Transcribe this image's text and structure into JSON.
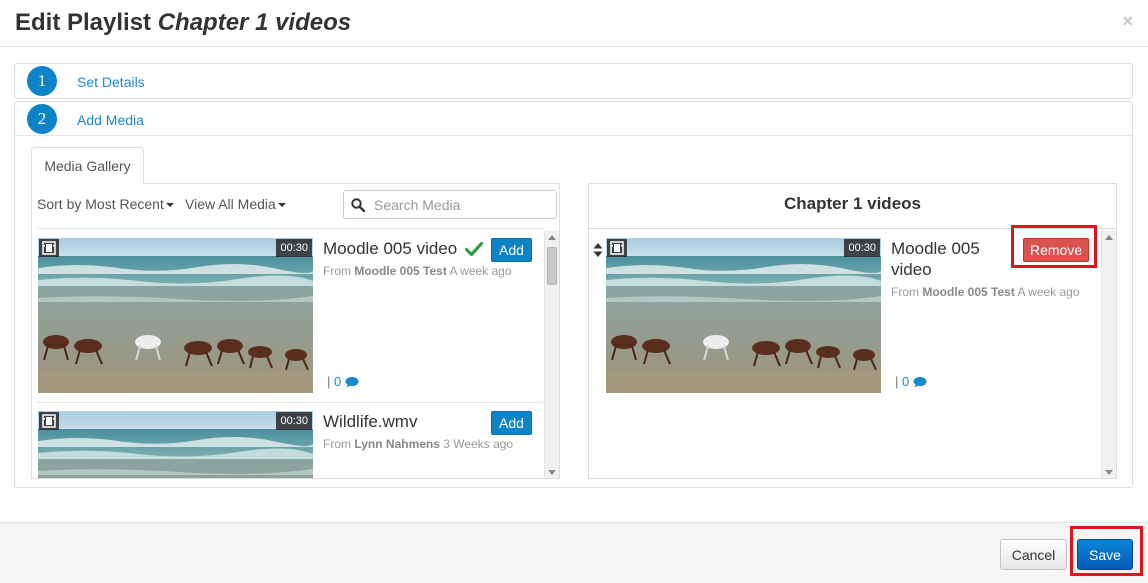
{
  "modal": {
    "title_prefix": "Edit Playlist",
    "title_name": "Chapter 1 videos",
    "close_glyph": "×"
  },
  "steps": [
    {
      "number": "1",
      "label": "Set Details"
    },
    {
      "number": "2",
      "label": "Add Media"
    }
  ],
  "gallery": {
    "tab_label": "Media Gallery",
    "sort_label": "Sort by Most Recent",
    "view_label": "View All Media",
    "search_placeholder": "Search Media",
    "items": [
      {
        "title": "Moodle 005 video",
        "from_label": "From",
        "author": "Moodle 005 Test",
        "time": "A week ago",
        "duration": "00:30",
        "comments": "0",
        "button": "Add",
        "added": true
      },
      {
        "title": "Wildlife.wmv",
        "from_label": "From",
        "author": "Lynn Nahmens",
        "time": "3 Weeks ago",
        "duration": "00:30",
        "button": "Add",
        "added": false
      }
    ]
  },
  "playlist": {
    "title": "Chapter 1 videos",
    "items": [
      {
        "title": "Moodle 005 video",
        "from_label": "From",
        "author": "Moodle 005 Test",
        "time": "A week ago",
        "duration": "00:30",
        "comments": "0",
        "button": "Remove"
      }
    ]
  },
  "footer": {
    "cancel_label": "Cancel",
    "save_label": "Save"
  },
  "colors": {
    "primary": "#0e84c8",
    "danger": "#d9534f",
    "highlight": "#e0141e",
    "success": "#3c9a4b"
  },
  "icons": {
    "film": "film-icon",
    "search": "search-icon",
    "check": "check-icon",
    "comment": "comment-icon",
    "drag": "sort-handle-icon"
  }
}
